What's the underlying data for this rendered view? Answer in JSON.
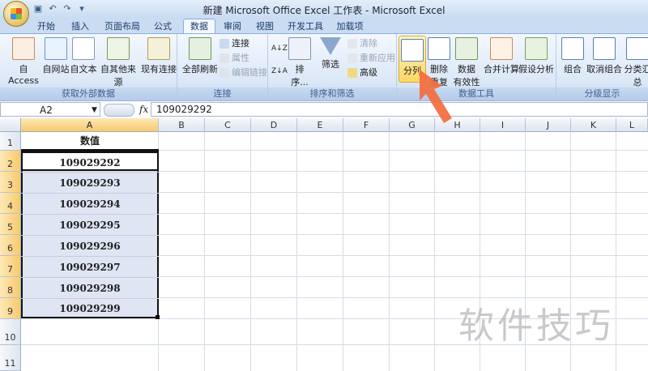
{
  "window": {
    "title": "新建 Microsoft Office Excel 工作表 - Microsoft Excel"
  },
  "tabs": [
    {
      "label": "开始"
    },
    {
      "label": "插入"
    },
    {
      "label": "页面布局"
    },
    {
      "label": "公式"
    },
    {
      "label": "数据",
      "active": true
    },
    {
      "label": "审阅"
    },
    {
      "label": "视图"
    },
    {
      "label": "开发工具"
    },
    {
      "label": "加载项"
    }
  ],
  "ribbon": {
    "get_external": {
      "label": "获取外部数据",
      "access": "自 Access",
      "web": "自网站",
      "text": "自文本",
      "other": "自其他来源",
      "existing": "现有连接"
    },
    "connections": {
      "label": "连接",
      "refresh_all": "全部刷新",
      "connections": "连接",
      "properties": "属性",
      "edit_links": "编辑链接"
    },
    "sort_filter": {
      "label": "排序和筛选",
      "sort": "排序...",
      "filter": "筛选",
      "clear": "清除",
      "reapply": "重新应用",
      "advanced": "高级",
      "az": "A↓Z",
      "za": "Z↓A"
    },
    "data_tools": {
      "label": "数据工具",
      "text_to_columns": "分列",
      "remove_dup_1": "删除",
      "remove_dup_2": "重复项",
      "validation_1": "数据",
      "validation_2": "有效性",
      "consolidate": "合并计算",
      "what_if": "假设分析"
    },
    "outline": {
      "label": "分级显示",
      "group": "组合",
      "ungroup": "取消组合",
      "subtotal": "分类汇总"
    }
  },
  "formula_bar": {
    "name_box": "A2",
    "fx": "fx",
    "value": "109029292"
  },
  "columns": [
    "A",
    "B",
    "C",
    "D",
    "E",
    "F",
    "G",
    "H",
    "I",
    "J",
    "K",
    "L"
  ],
  "rows": [
    "1",
    "2",
    "3",
    "4",
    "5",
    "6",
    "7",
    "8",
    "9",
    "10",
    "11"
  ],
  "cells": {
    "header": "数值",
    "values": [
      "109029292",
      "109029293",
      "109029294",
      "109029295",
      "109029296",
      "109029297",
      "109029298",
      "109029299"
    ]
  },
  "watermark": "软件技巧",
  "colors": {
    "accent": "#f26d3d",
    "selection": "#dfe5f2",
    "ribbon": "#dce8f7"
  }
}
